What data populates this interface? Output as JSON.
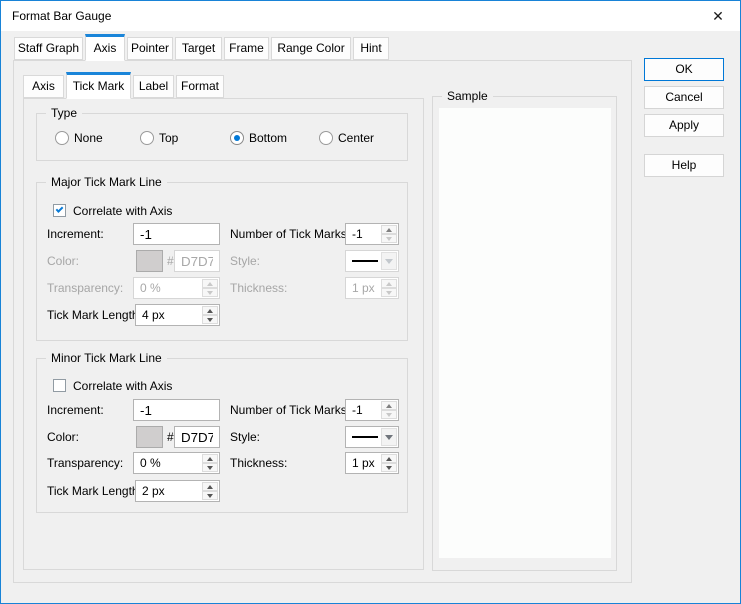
{
  "window": {
    "title": "Format Bar Gauge"
  },
  "icons": {
    "close": "✕"
  },
  "tabs": {
    "items": [
      "Staff Graph",
      "Axis",
      "Pointer",
      "Target",
      "Frame",
      "Range Color",
      "Hint"
    ],
    "active": "Axis"
  },
  "subtabs": {
    "items": [
      "Axis",
      "Tick Mark",
      "Label",
      "Format"
    ],
    "active": "Tick Mark"
  },
  "type_group": {
    "title": "Type",
    "options": [
      "None",
      "Top",
      "Bottom",
      "Center"
    ],
    "selected": "Bottom"
  },
  "major": {
    "title": "Major Tick Mark Line",
    "correlate": {
      "label": "Correlate with Axis",
      "checked": true
    },
    "increment": {
      "label": "Increment:",
      "value": "-1"
    },
    "num_ticks": {
      "label": "Number of Tick Marks:",
      "value": "-1"
    },
    "color": {
      "label": "Color:",
      "hash": "#",
      "hex": "D7D7D7",
      "swatch": "#d0cece",
      "disabled": true
    },
    "style": {
      "label": "Style:",
      "disabled": true
    },
    "transparency": {
      "label": "Transparency:",
      "value": "0 %",
      "disabled": true
    },
    "thickness": {
      "label": "Thickness:",
      "value": "1 px",
      "disabled": true
    },
    "tick_length": {
      "label": "Tick Mark Length:",
      "value": "4 px"
    }
  },
  "minor": {
    "title": "Minor Tick Mark Line",
    "correlate": {
      "label": "Correlate with Axis",
      "checked": false
    },
    "increment": {
      "label": "Increment:",
      "value": "-1"
    },
    "num_ticks": {
      "label": "Number of Tick Marks:",
      "value": "-1"
    },
    "color": {
      "label": "Color:",
      "hash": "#",
      "hex": "D7D7D7",
      "swatch": "#d0cece",
      "disabled": false
    },
    "style": {
      "label": "Style:",
      "disabled": false
    },
    "transparency": {
      "label": "Transparency:",
      "value": "0 %",
      "disabled": false
    },
    "thickness": {
      "label": "Thickness:",
      "value": "1 px",
      "disabled": false
    },
    "tick_length": {
      "label": "Tick Mark Length:",
      "value": "2 px"
    }
  },
  "sample": {
    "title": "Sample"
  },
  "action_buttons": {
    "ok": "OK",
    "cancel": "Cancel",
    "apply": "Apply",
    "help": "Help"
  },
  "colors": {
    "accent": "#0078d7",
    "window_border": "#1883d7",
    "disabled_text": "#a6a6a6"
  }
}
